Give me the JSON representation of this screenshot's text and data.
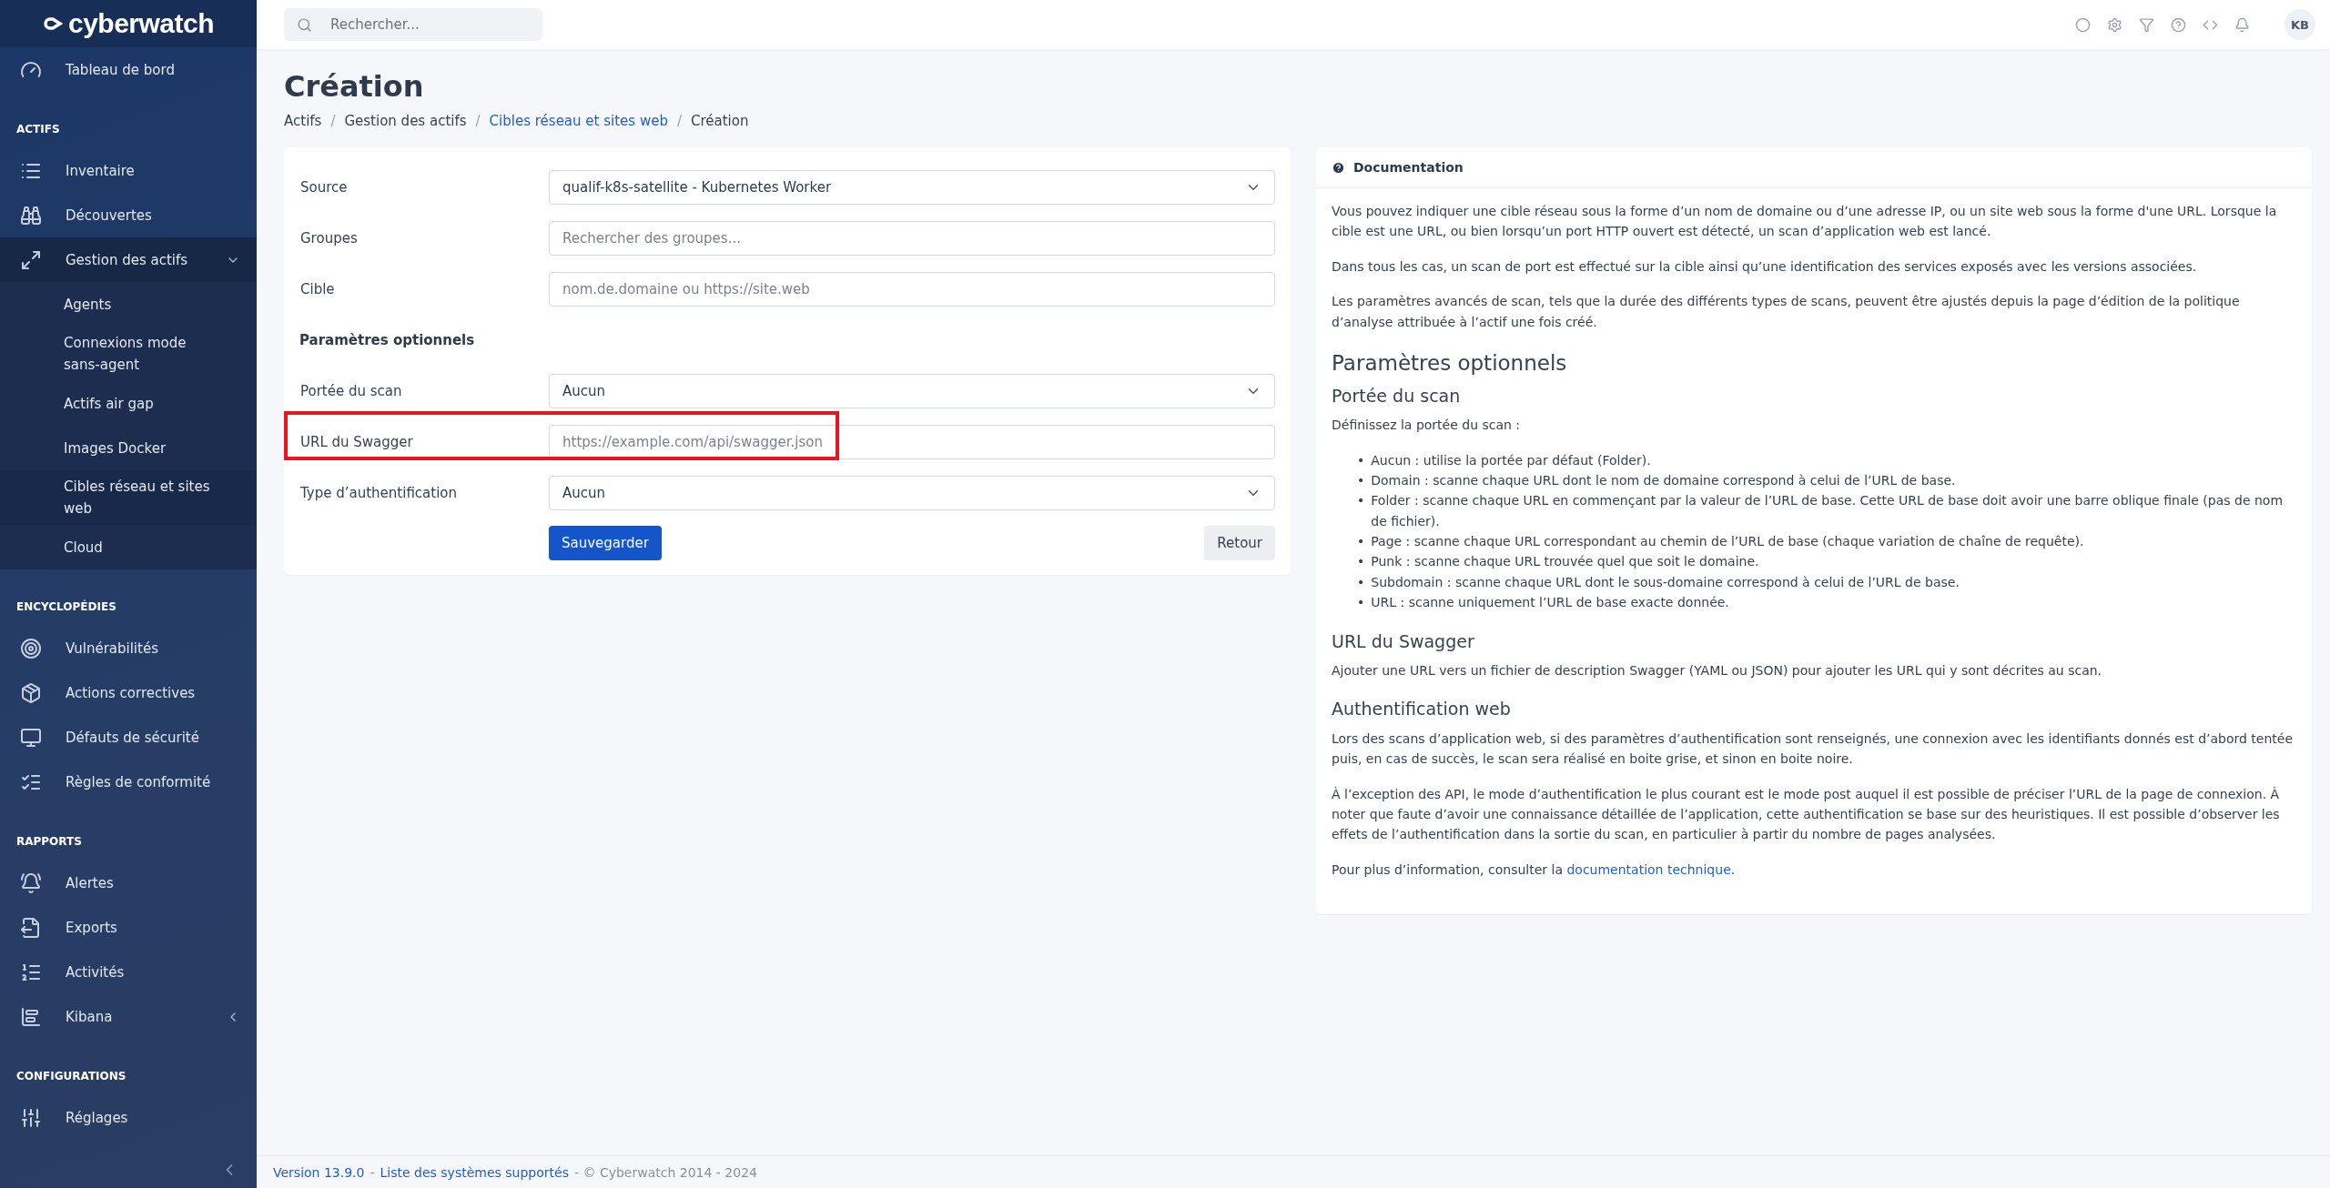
{
  "brand": {
    "name": "cyberwatch"
  },
  "sidebar": {
    "items": [
      {
        "kind": "item",
        "label": "Tableau de bord",
        "selected": false
      },
      {
        "kind": "section",
        "label": "ACTIFS"
      },
      {
        "kind": "item",
        "label": "Inventaire",
        "selected": false
      },
      {
        "kind": "item",
        "label": "Découvertes",
        "selected": false
      },
      {
        "kind": "group",
        "label": "Gestion des actifs",
        "expanded": true,
        "children": [
          {
            "label": "Agents",
            "selected": false
          },
          {
            "label": "Connexions mode sans-agent",
            "selected": false
          },
          {
            "label": "Actifs air gap",
            "selected": false
          },
          {
            "label": "Images Docker",
            "selected": false
          },
          {
            "label": "Cibles réseau et sites web",
            "selected": true
          },
          {
            "label": "Cloud",
            "selected": false
          }
        ]
      },
      {
        "kind": "section",
        "label": "ENCYCLOPÉDIES"
      },
      {
        "kind": "item",
        "label": "Vulnérabilités",
        "selected": false
      },
      {
        "kind": "item",
        "label": "Actions correctives",
        "selected": false
      },
      {
        "kind": "item",
        "label": "Défauts de sécurité",
        "selected": false
      },
      {
        "kind": "item",
        "label": "Règles de conformité",
        "selected": false
      },
      {
        "kind": "section",
        "label": "RAPPORTS"
      },
      {
        "kind": "item",
        "label": "Alertes",
        "selected": false
      },
      {
        "kind": "item",
        "label": "Exports",
        "selected": false
      },
      {
        "kind": "item",
        "label": "Activités",
        "selected": false
      },
      {
        "kind": "group",
        "label": "Kibana",
        "expanded": false
      },
      {
        "kind": "section",
        "label": "CONFIGURATIONS"
      },
      {
        "kind": "item",
        "label": "Réglages",
        "selected": false
      }
    ]
  },
  "topbar": {
    "search": {
      "placeholder": "Rechercher..."
    },
    "avatar": "KB"
  },
  "page": {
    "title": "Création",
    "separator": "/",
    "breadcrumb": [
      {
        "label": "Actifs",
        "link": false
      },
      {
        "label": "Gestion des actifs",
        "link": false
      },
      {
        "label": "Cibles réseau et sites web",
        "link": true
      },
      {
        "label": "Création",
        "link": false
      }
    ]
  },
  "form": {
    "fields": [
      {
        "kind": "select",
        "label": "Source",
        "value": "qualif-k8s-satellite - Kubernetes Worker"
      },
      {
        "kind": "input",
        "label": "Groupes",
        "placeholder": "Rechercher des groupes..."
      },
      {
        "kind": "input",
        "label": "Cible",
        "placeholder": "nom.de.domaine ou https://site.web"
      },
      {
        "kind": "heading",
        "label": "Paramètres optionnels"
      },
      {
        "kind": "select",
        "label": "Portée du scan",
        "value": "Aucun"
      },
      {
        "kind": "input",
        "label": "URL du Swagger",
        "placeholder": "https://example.com/api/swagger.json",
        "highlighted": true
      },
      {
        "kind": "select",
        "label": "Type d’authentification",
        "value": "Aucun"
      }
    ],
    "buttons": {
      "save": "Sauvegarder",
      "back": "Retour"
    }
  },
  "documentation": {
    "title": "Documentation",
    "blocks": [
      {
        "kind": "p",
        "text": "Vous pouvez indiquer une cible réseau sous la forme d’un nom de domaine ou d’une adresse IP, ou un site web sous la forme d'une URL. Lorsque la cible est une URL, ou bien lorsqu’un port HTTP ouvert est détecté, un scan d’application web est lancé."
      },
      {
        "kind": "p",
        "text": "Dans tous les cas, un scan de port est effectué sur la cible ainsi qu’une identification des services exposés avec les versions associées."
      },
      {
        "kind": "p",
        "text": "Les paramètres avancés de scan, tels que la durée des différents types de scans, peuvent être ajustés depuis la page d’édition de la politique d’analyse attribuée à l’actif une fois créé."
      },
      {
        "kind": "h2",
        "text": "Paramètres optionnels"
      },
      {
        "kind": "h3",
        "text": "Portée du scan"
      },
      {
        "kind": "p",
        "text": "Définissez la portée du scan :"
      },
      {
        "kind": "ul",
        "marker": "•",
        "items": [
          "Aucun : utilise la portée par défaut (Folder).",
          "Domain : scanne chaque URL dont le nom de domaine correspond à celui de l’URL de base.",
          "Folder : scanne chaque URL en commençant par la valeur de l’URL de base. Cette URL de base doit avoir une barre oblique finale (pas de nom de fichier).",
          "Page : scanne chaque URL correspondant au chemin de l’URL de base (chaque variation de chaîne de requête).",
          "Punk : scanne chaque URL trouvée quel que soit le domaine.",
          "Subdomain : scanne chaque URL dont le sous-domaine correspond à celui de l’URL de base.",
          "URL : scanne uniquement l’URL de base exacte donnée."
        ]
      },
      {
        "kind": "h3",
        "text": "URL du Swagger"
      },
      {
        "kind": "p",
        "text": "Ajouter une URL vers un fichier de description Swagger (YAML ou JSON) pour ajouter les URL qui y sont décrites au scan."
      },
      {
        "kind": "h3",
        "text": "Authentification web"
      },
      {
        "kind": "p",
        "text": "Lors des scans d’application web, si des paramètres d’authentification sont renseignés, une connexion avec les identifiants donnés est d’abord tentée puis, en cas de succès, le scan sera réalisé en boite grise, et sinon en boite noire."
      },
      {
        "kind": "p",
        "text": "À l’exception des API, le mode d’authentification le plus courant est le mode post auquel il est possible de préciser l’URL de la page de connexion. À noter que faute d’avoir une connaissance détaillée de l’application, cette authentification se base sur des heuristiques. Il est possible d’observer les effets de l’authentification dans la sortie du scan, en particulier à partir du nombre de pages analysées."
      },
      {
        "kind": "link_p",
        "text": "Pour plus d’information, consulter la",
        "link": "documentation technique",
        "after": "."
      }
    ]
  },
  "footer": {
    "version": "Version 13.9.0",
    "separator": "-",
    "systems": "Liste des systèmes supportés",
    "copyright": "- © Cyberwatch 2014 - 2024"
  }
}
